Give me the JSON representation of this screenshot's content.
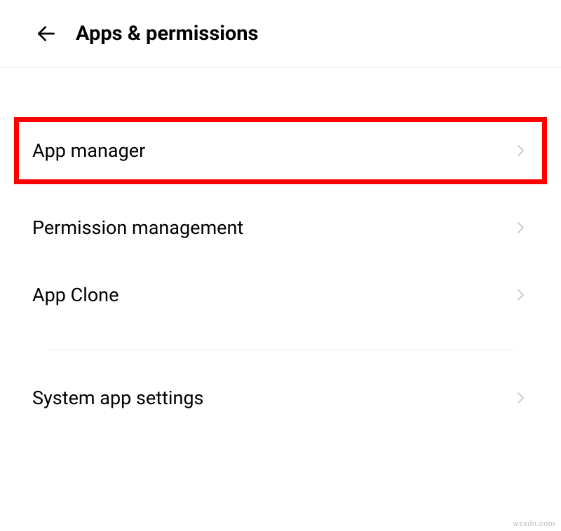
{
  "header": {
    "title": "Apps & permissions"
  },
  "items": {
    "app_manager": "App manager",
    "permission_management": "Permission management",
    "app_clone": "App Clone",
    "system_app_settings": "System app settings"
  },
  "watermark": "wsxdn.com"
}
